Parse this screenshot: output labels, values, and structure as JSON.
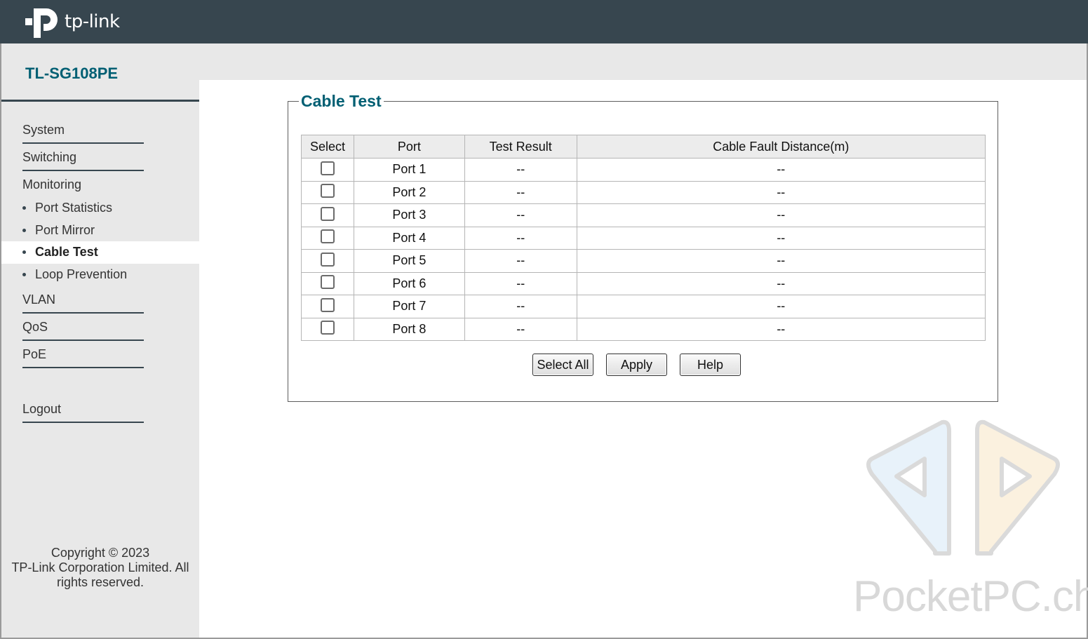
{
  "header": {
    "brand": "tp-link",
    "bg_color": "#37464f"
  },
  "sidebar": {
    "model": "TL-SG108PE",
    "items": {
      "system": "System",
      "switching": "Switching",
      "monitoring": "Monitoring",
      "port_statistics": "Port Statistics",
      "port_mirror": "Port Mirror",
      "cable_test": "Cable Test",
      "loop_prevention": "Loop Prevention",
      "vlan": "VLAN",
      "qos": "QoS",
      "poe": "PoE",
      "logout": "Logout"
    },
    "active_item": "Cable Test",
    "copyright_lines": [
      "Copyright © 2023",
      "TP-Link Corporation Limited. All",
      "rights reserved."
    ]
  },
  "panel": {
    "title": "Cable Test",
    "title_color": "#005f73",
    "columns": [
      "Select",
      "Port",
      "Test Result",
      "Cable Fault Distance(m)"
    ],
    "rows": [
      {
        "port": "Port 1",
        "result": "--",
        "distance": "--",
        "selected": false
      },
      {
        "port": "Port 2",
        "result": "--",
        "distance": "--",
        "selected": false
      },
      {
        "port": "Port 3",
        "result": "--",
        "distance": "--",
        "selected": false
      },
      {
        "port": "Port 4",
        "result": "--",
        "distance": "--",
        "selected": false
      },
      {
        "port": "Port 5",
        "result": "--",
        "distance": "--",
        "selected": false
      },
      {
        "port": "Port 6",
        "result": "--",
        "distance": "--",
        "selected": false
      },
      {
        "port": "Port 7",
        "result": "--",
        "distance": "--",
        "selected": false
      },
      {
        "port": "Port 8",
        "result": "--",
        "distance": "--",
        "selected": false
      }
    ],
    "buttons": {
      "select_all": "Select All",
      "apply": "Apply",
      "help": "Help"
    }
  },
  "watermark": {
    "text": "PocketPC.ch",
    "icon": "pocketpc-logo-icon"
  }
}
